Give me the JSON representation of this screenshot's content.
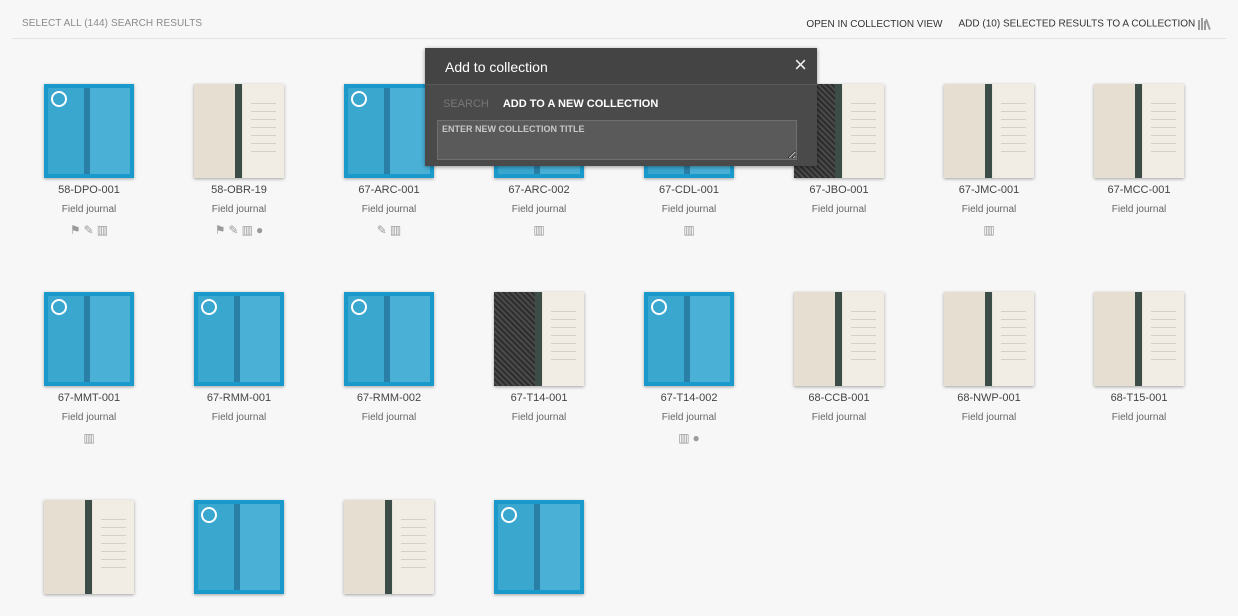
{
  "header": {
    "select_all": "SELECT ALL (144) SEARCH RESULTS",
    "open_collection_view": "OPEN IN COLLECTION VIEW",
    "add_selected": "ADD (10) SELECTED RESULTS TO A COLLECTION"
  },
  "modal": {
    "title": "Add to collection",
    "close": "×",
    "tab_search": "SEARCH",
    "tab_new": "ADD TO A NEW COLLECTION",
    "input_placeholder": "ENTER NEW COLLECTION TITLE"
  },
  "items": [
    {
      "name": "58-DPO-001",
      "type": "Field journal",
      "icons": [
        "flag-icon",
        "pencil-icon",
        "library-icon"
      ],
      "selected": true
    },
    {
      "name": "58-OBR-19",
      "type": "Field journal",
      "icons": [
        "flag-icon",
        "pencil-icon",
        "library-icon",
        "comment-icon"
      ],
      "selected": false
    },
    {
      "name": "67-ARC-001",
      "type": "Field journal",
      "icons": [
        "pencil-icon",
        "library-icon"
      ],
      "selected": true
    },
    {
      "name": "67-ARC-002",
      "type": "Field journal",
      "icons": [
        "library-icon"
      ],
      "selected": true
    },
    {
      "name": "67-CDL-001",
      "type": "Field journal",
      "icons": [
        "library-icon"
      ],
      "selected": true
    },
    {
      "name": "67-JBO-001",
      "type": "Field journal",
      "icons": [],
      "selected": false
    },
    {
      "name": "67-JMC-001",
      "type": "Field journal",
      "icons": [
        "library-icon"
      ],
      "selected": false
    },
    {
      "name": "67-MCC-001",
      "type": "Field journal",
      "icons": [],
      "selected": false
    },
    {
      "name": "67-MMT-001",
      "type": "Field journal",
      "icons": [
        "library-icon"
      ],
      "selected": true
    },
    {
      "name": "67-RMM-001",
      "type": "Field journal",
      "icons": [],
      "selected": true
    },
    {
      "name": "67-RMM-002",
      "type": "Field journal",
      "icons": [],
      "selected": true
    },
    {
      "name": "67-T14-001",
      "type": "Field journal",
      "icons": [],
      "selected": false
    },
    {
      "name": "67-T14-002",
      "type": "Field journal",
      "icons": [
        "library-icon",
        "comment-icon"
      ],
      "selected": true
    },
    {
      "name": "68-CCB-001",
      "type": "Field journal",
      "icons": [],
      "selected": false
    },
    {
      "name": "68-NWP-001",
      "type": "Field journal",
      "icons": [],
      "selected": false
    },
    {
      "name": "68-T15-001",
      "type": "Field journal",
      "icons": [],
      "selected": false
    },
    {
      "name": "",
      "type": "",
      "icons": [],
      "selected": false
    },
    {
      "name": "",
      "type": "",
      "icons": [],
      "selected": true
    },
    {
      "name": "",
      "type": "",
      "icons": [],
      "selected": false
    },
    {
      "name": "",
      "type": "",
      "icons": [],
      "selected": true
    }
  ]
}
